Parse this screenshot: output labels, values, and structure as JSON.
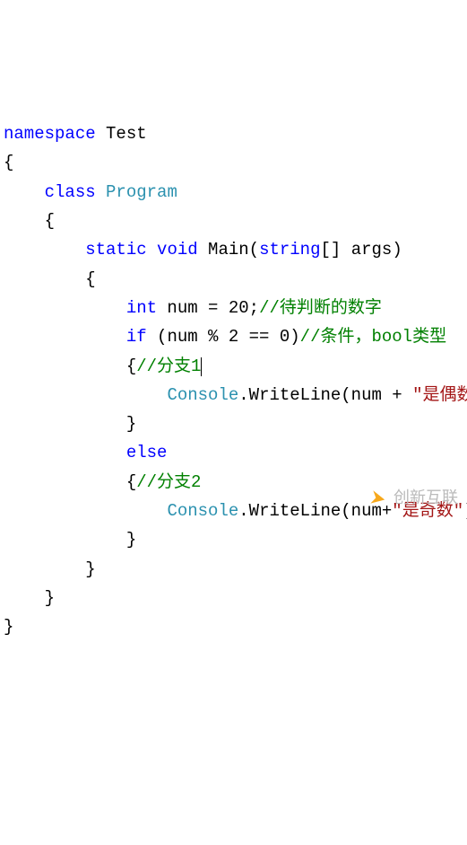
{
  "code": {
    "l1_kw": "namespace",
    "l1_name": " Test",
    "l2": "{",
    "l3_kw": "    class",
    "l3_type": " Program",
    "l4": "    {",
    "l5_kw1": "        static",
    "l5_kw2": " void",
    "l5_name": " Main(",
    "l5_kw3": "string",
    "l5_rest": "[] args)",
    "l6": "        {",
    "l7_kw": "            int",
    "l7_rest": " num = 20;",
    "l7_comment": "//待判断的数字",
    "l8_kw": "            if",
    "l8_rest": " (num % 2 == 0)",
    "l8_comment": "//条件，bool类型",
    "l9_brace": "            {",
    "l9_comment": "//分支1",
    "l10_pad": "                ",
    "l10_type": "Console",
    "l10_rest": ".WriteLine(num + ",
    "l10_str": "\"是偶数\"",
    "l10_end": ");",
    "l11": "            }",
    "l12_kw": "            else",
    "l13_brace": "            {",
    "l13_comment": "//分支2",
    "l14_pad": "                ",
    "l14_type": "Console",
    "l14_rest": ".WriteLine(num+",
    "l14_str": "\"是奇数\"",
    "l14_end": ");",
    "l15": "            }",
    "l16": "        }",
    "l17": "    }",
    "l18": "}"
  },
  "watermark": {
    "text": "创新互联"
  }
}
